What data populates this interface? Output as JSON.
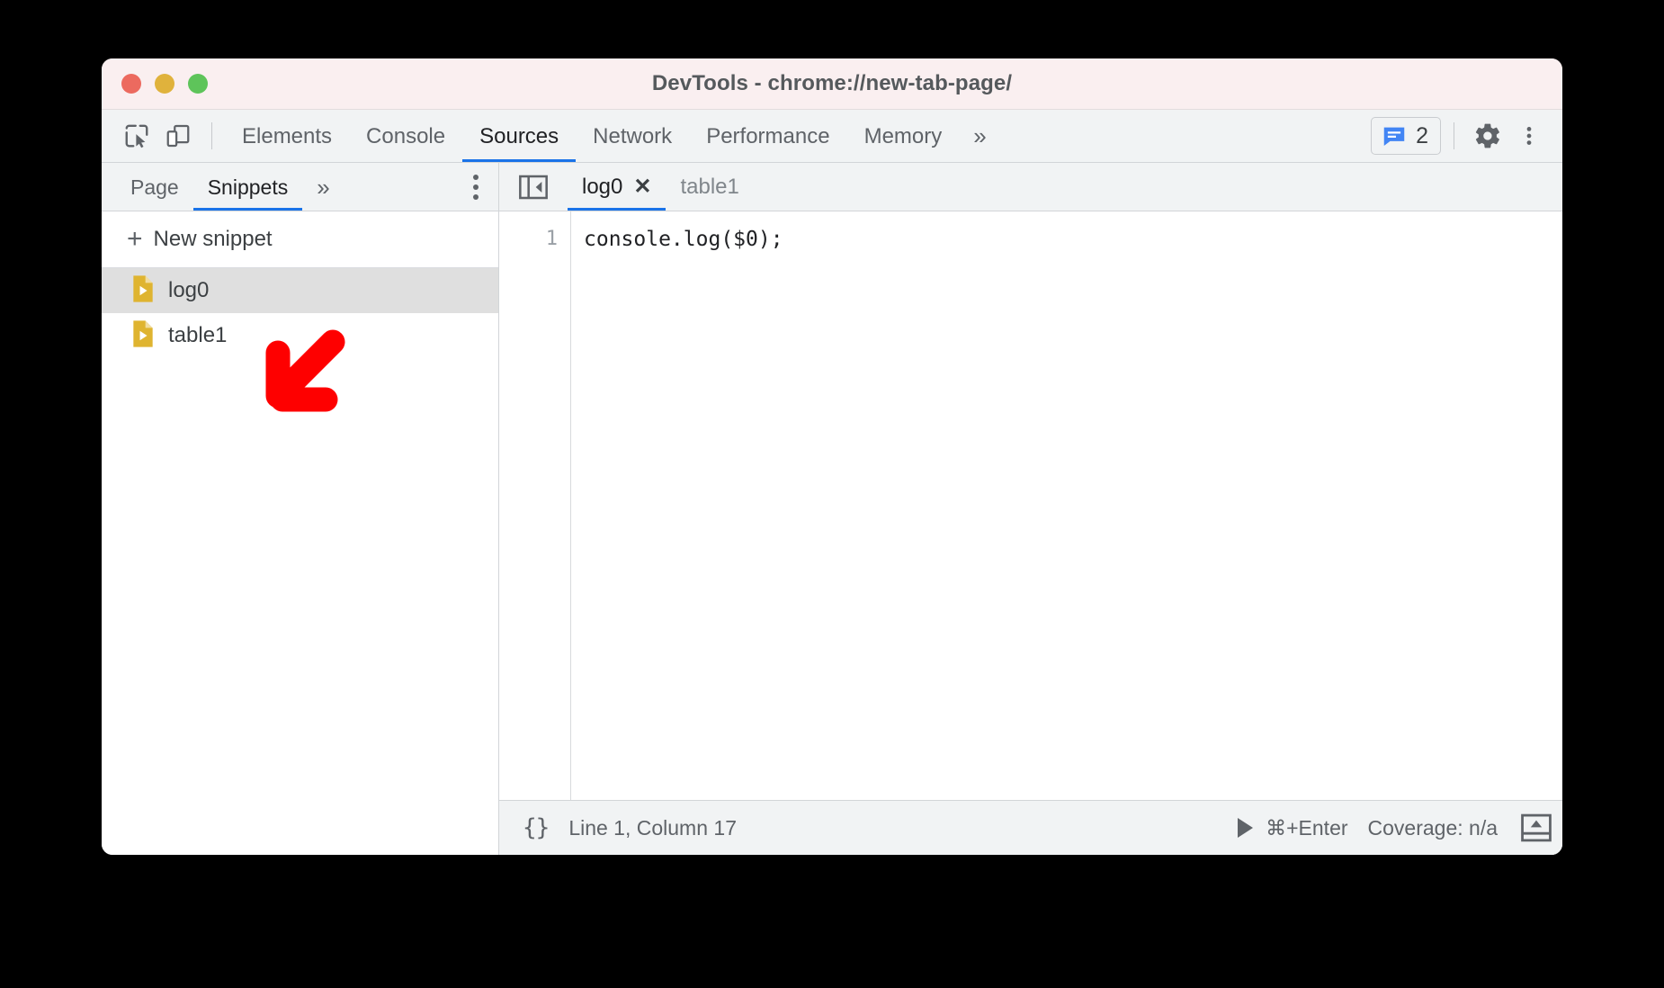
{
  "window": {
    "title": "DevTools - chrome://new-tab-page/",
    "traffic_lights": [
      "close",
      "minimize",
      "maximize"
    ],
    "colors": {
      "titlebar_bg": "#faeff0",
      "toolbar_bg": "#f1f3f4",
      "accent": "#1a73e8",
      "selected_row": "#dfdfdf",
      "snippet_icon": "#dfb430",
      "annotation": "#fe0000"
    }
  },
  "toolbar": {
    "inspect_icon": "inspect-element-icon",
    "device_icon": "device-toolbar-icon",
    "tabs": [
      {
        "label": "Elements",
        "active": false
      },
      {
        "label": "Console",
        "active": false
      },
      {
        "label": "Sources",
        "active": true
      },
      {
        "label": "Network",
        "active": false
      },
      {
        "label": "Performance",
        "active": false
      },
      {
        "label": "Memory",
        "active": false
      }
    ],
    "more_tabs": "»",
    "message_badge": {
      "icon": "message-bubble-icon",
      "count": "2"
    },
    "settings_icon": "gear-icon",
    "more_icon": "dots-vertical-icon"
  },
  "sidebar": {
    "tabs": [
      {
        "label": "Page",
        "active": false
      },
      {
        "label": "Snippets",
        "active": true
      }
    ],
    "more_tabs": "»",
    "more_options_icon": "dots-vertical-icon",
    "new_snippet": {
      "plus": "+",
      "label": "New snippet"
    },
    "snippets": [
      {
        "name": "log0",
        "selected": true
      },
      {
        "name": "table1",
        "selected": false
      }
    ]
  },
  "editor": {
    "collapse_icon": "collapse-sidebar-icon",
    "tabs": [
      {
        "label": "log0",
        "active": true,
        "closable": true,
        "close": "✕"
      },
      {
        "label": "table1",
        "active": false,
        "closable": false
      }
    ],
    "lines": [
      {
        "number": "1",
        "text": "console.log($0);"
      }
    ]
  },
  "statusbar": {
    "pretty_print": "{}",
    "cursor_position": "Line 1, Column 17",
    "run_shortcut": "⌘+Enter",
    "run_icon": "play-icon",
    "coverage": "Coverage: n/a",
    "drawer_icon": "show-drawer-icon"
  },
  "annotation": {
    "arrow": "red-arrow-down-left",
    "color": "#fe0000"
  }
}
